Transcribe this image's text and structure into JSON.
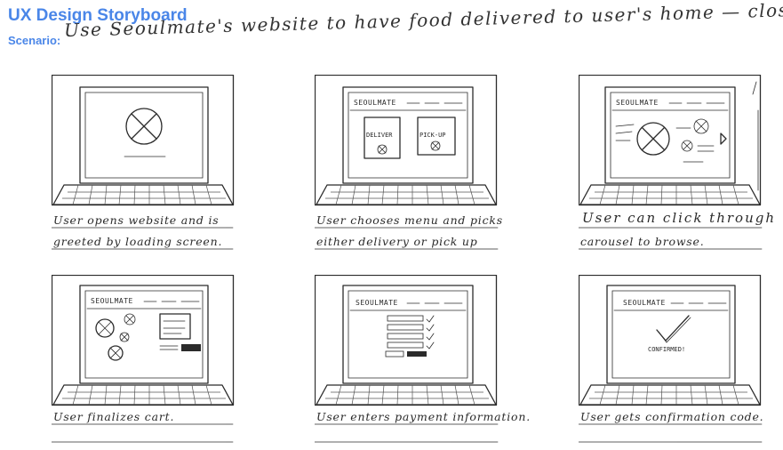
{
  "header": {
    "title": "UX Design Storyboard",
    "scenario_label": "Scenario:",
    "scenario_text": "Use Seoulmate's website to have food delivered to user's home — close up"
  },
  "panels": [
    {
      "caption_1": "User opens website and is",
      "caption_2": "greeted by loading screen."
    },
    {
      "brand": "SEOULMATE",
      "deliver_label": "DELIVER",
      "pickup_label": "PICK-UP",
      "caption_1": "User chooses menu and picks",
      "caption_2": "either delivery or pick up"
    },
    {
      "brand": "SEOULMATE",
      "caption_1": "User can click through",
      "caption_2": "carousel to browse."
    },
    {
      "brand": "SEOULMATE",
      "caption_1": "User finalizes cart.",
      "caption_2": ""
    },
    {
      "brand": "SEOULMATE",
      "caption_1": "User enters payment information.",
      "caption_2": ""
    },
    {
      "brand": "SEOULMATE",
      "confirm_label": "CONFIRMED!",
      "caption_1": "User gets confirmation code.",
      "caption_2": ""
    }
  ],
  "colors": {
    "accent": "#4a86e8",
    "ink": "#2b2b2b"
  }
}
